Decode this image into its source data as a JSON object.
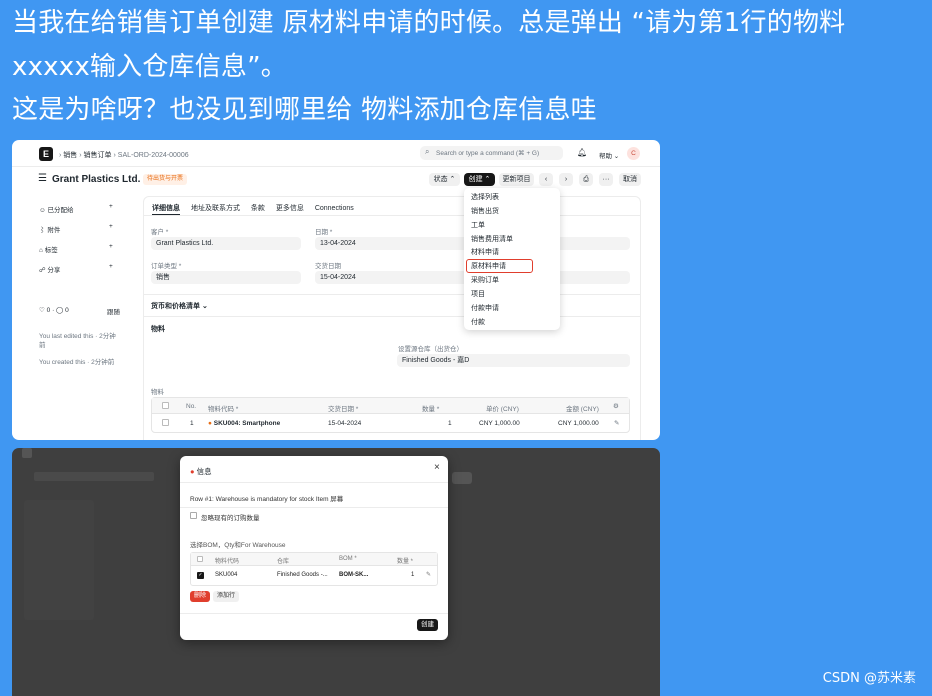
{
  "question": {
    "line1": "当我在给销售订单创建  原材料申请的时候。总是弹出 “请为第1行的物料",
    "line2": "xxxxx输入仓库信息”。",
    "line3": "这是为啥呀？也没见到哪里给 物料添加仓库信息哇"
  },
  "topbar": {
    "logo": "E",
    "crumb1": "销售",
    "crumb2": "销售订单",
    "crumb3": "SAL-ORD-2024-00006",
    "search_placeholder": "Search or type a command (⌘ + G)",
    "help": "帮助",
    "avatar": "C"
  },
  "header": {
    "title": "Grant Plastics Ltd.",
    "badge": "待出货与开票",
    "status_btn": "状态",
    "create_btn": "创建",
    "update_btn": "更新项目",
    "more_btn": "···",
    "cancel_btn": "取消"
  },
  "sidebar": {
    "assigned": "已分配给",
    "attachments": "附件",
    "tags": "标签",
    "share": "分享",
    "likes": "0",
    "comments": "0",
    "follow": "跟随",
    "edited": "You last edited this · 2分钟",
    "edited2": "前",
    "created": "You created this · 2分钟前"
  },
  "tabs": [
    "详细信息",
    "地址及联系方式",
    "条款",
    "更多信息",
    "Connections"
  ],
  "form": {
    "customer_label": "客户 *",
    "customer_value": "Grant Plastics Ltd.",
    "date_label": "日期 *",
    "date_value": "13-04-2024",
    "order_type_label": "订单类型 *",
    "order_type_value": "销售",
    "delivery_label": "交货日期",
    "delivery_value": "15-04-2024",
    "section_currency": "货币和价格清单",
    "section_items": "物料",
    "warehouse_label": "设置源仓库（出货仓）",
    "warehouse_value": "Finished Goods - 嘉D",
    "items_label": "物料"
  },
  "items_table": {
    "headers": [
      "No.",
      "物料代码 *",
      "交货日期 *",
      "数量 *",
      "单价 (CNY)",
      "金额 (CNY)"
    ],
    "row": {
      "no": "1",
      "code": "SKU004: Smartphone",
      "date": "15-04-2024",
      "qty": "1",
      "rate": "CNY 1,000.00",
      "amount": "CNY 1,000.00"
    }
  },
  "create_menu": {
    "items": [
      "选择列表",
      "销售出货",
      "工单",
      "销售费用清单",
      "材料申请",
      "原材料申请",
      "采购订单",
      "项目",
      "付款申请",
      "付款"
    ],
    "highlight_color": "#e03e2d"
  },
  "dialog": {
    "title": "信息",
    "message": "Row #1: Warehouse is mandatory for stock Item 屏幕",
    "checkbox_label": "忽略现有的订购数量",
    "section_label": "选择BOM，Qty和For Warehouse",
    "headers": [
      "物料代码",
      "仓库",
      "BOM *",
      "数量 *"
    ],
    "row": {
      "code": "SKU004",
      "warehouse": "Finished Goods -...",
      "bom": "BOM-SK...",
      "qty": "1"
    },
    "delete_btn": "删除",
    "add_row_btn": "添加行",
    "create_btn": "创建"
  },
  "watermark": "CSDN @苏米素"
}
